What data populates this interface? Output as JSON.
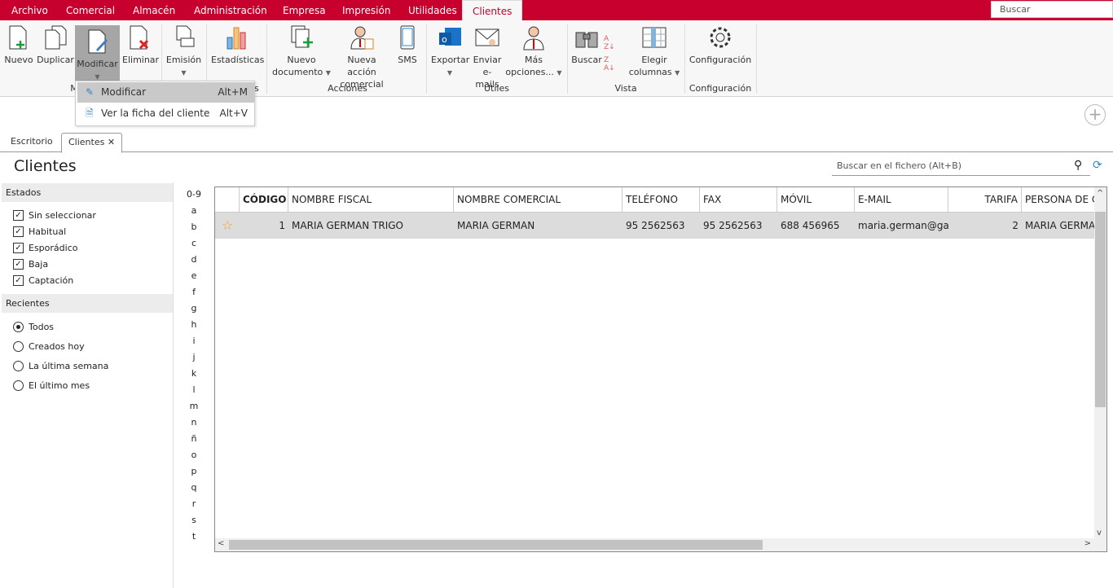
{
  "menubar": {
    "items": [
      "Archivo",
      "Comercial",
      "Almacén",
      "Administración",
      "Empresa",
      "Impresión",
      "Utilidades",
      "Clientes"
    ],
    "active": "Clientes",
    "search_placeholder": "Buscar"
  },
  "ribbon": {
    "buttons": {
      "nuevo": "Nuevo",
      "duplicar": "Duplicar",
      "modificar": "Modificar",
      "eliminar": "Eliminar",
      "emision": "Emisión",
      "estadisticas": "Estadísticas",
      "nuevo_documento_1": "Nuevo",
      "nuevo_documento_2": "documento",
      "nueva_accion_1": "Nueva acción",
      "nueva_accion_2": "comercial",
      "sms": "SMS",
      "exportar": "Exportar",
      "enviar_1": "Enviar",
      "enviar_2": "e-mails",
      "mas_1": "Más",
      "mas_2": "opciones...",
      "buscar": "Buscar",
      "elegir_1": "Elegir",
      "elegir_2": "columnas",
      "configuracion": "Configuración"
    },
    "groups": {
      "mantenimiento": "M",
      "estadisticas": "s",
      "acciones": "Acciones",
      "utiles": "Útiles",
      "vista": "Vista",
      "configuracion": "Configuración"
    }
  },
  "dropdown": {
    "items": [
      {
        "label": "Modificar",
        "shortcut": "Alt+M"
      },
      {
        "label": "Ver la ficha del cliente",
        "shortcut": "Alt+V"
      }
    ]
  },
  "tabs": [
    {
      "label": "Escritorio"
    },
    {
      "label": "Clientes"
    }
  ],
  "page": {
    "title": "Clientes",
    "search_placeholder": "Buscar en el fichero (Alt+B)"
  },
  "sidebar": {
    "estados_title": "Estados",
    "estados": [
      {
        "label": "Sin seleccionar",
        "checked": true
      },
      {
        "label": "Habitual",
        "checked": true
      },
      {
        "label": "Esporádico",
        "checked": true
      },
      {
        "label": "Baja",
        "checked": true
      },
      {
        "label": "Captación",
        "checked": true
      }
    ],
    "recientes_title": "Recientes",
    "recientes": [
      {
        "label": "Todos",
        "selected": true
      },
      {
        "label": "Creados hoy",
        "selected": false
      },
      {
        "label": "La última semana",
        "selected": false
      },
      {
        "label": "El último mes",
        "selected": false
      }
    ]
  },
  "alphabet": [
    "0-9",
    "a",
    "b",
    "c",
    "d",
    "e",
    "f",
    "g",
    "h",
    "i",
    "j",
    "k",
    "l",
    "m",
    "n",
    "ñ",
    "o",
    "p",
    "q",
    "r",
    "s",
    "t"
  ],
  "grid": {
    "columns": [
      "",
      "CÓDIGO",
      "NOMBRE FISCAL",
      "NOMBRE COMERCIAL",
      "TELÉFONO",
      "FAX",
      "MÓVIL",
      "E-MAIL",
      "TARIFA",
      "PERSONA DE CONTACTO"
    ],
    "rows": [
      [
        "☆",
        "1",
        "MARIA GERMAN TRIGO",
        "MARIA GERMAN",
        "95 2562563",
        "95 2562563",
        "688 456965",
        "maria.german@ga...",
        "2",
        "MARIA GERMAN"
      ]
    ]
  },
  "colors": {
    "brand": "#c8002d",
    "selection": "#dcdcdc",
    "star": "#f0a030"
  }
}
